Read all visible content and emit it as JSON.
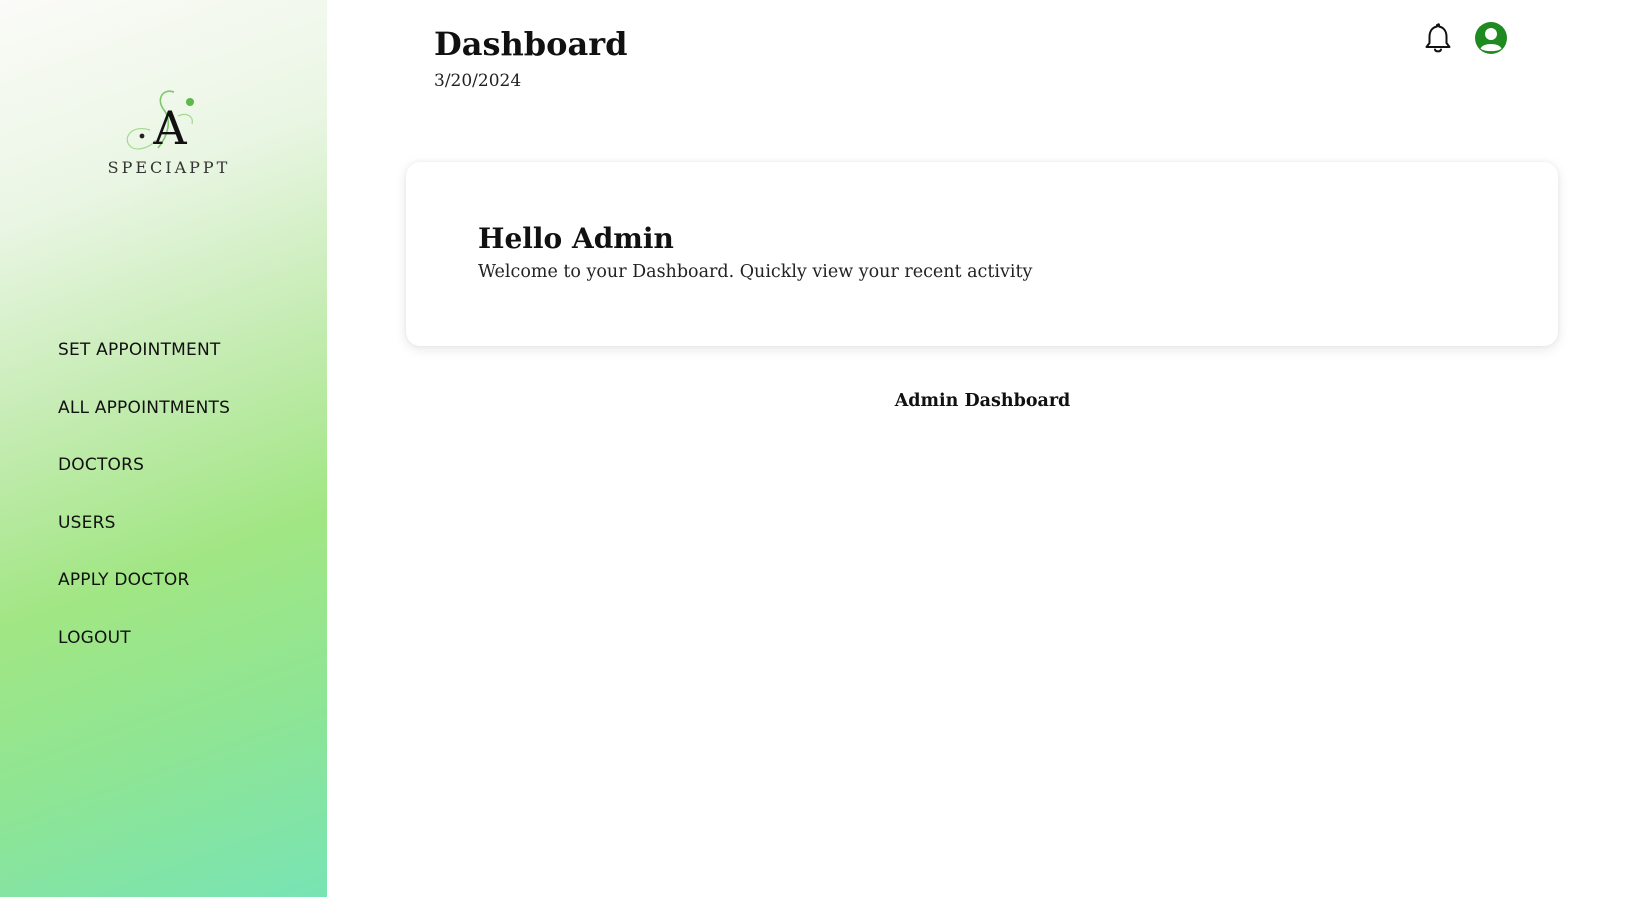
{
  "brand": {
    "name": "SPECIAPPT",
    "logo_letter": "A"
  },
  "sidebar": {
    "items": [
      {
        "label": "SET APPOINTMENT"
      },
      {
        "label": "ALL APPOINTMENTS"
      },
      {
        "label": "DOCTORS"
      },
      {
        "label": "USERS"
      },
      {
        "label": "APPLY DOCTOR"
      },
      {
        "label": "LOGOUT"
      }
    ]
  },
  "header": {
    "title": "Dashboard",
    "date": "3/20/2024",
    "icons": [
      "bell-icon",
      "user-avatar-icon"
    ]
  },
  "welcome_card": {
    "title": "Hello Admin",
    "subtitle": "Welcome to your Dashboard. Quickly view your recent activity"
  },
  "content": {
    "section_label": "Admin Dashboard"
  },
  "colors": {
    "accent": "#2e9e2e",
    "avatar": "#1f8a1f",
    "sidebar_gradient_start": "#fbfbf8",
    "sidebar_gradient_mid": "#a1e684",
    "sidebar_gradient_end": "#78e4b4"
  }
}
